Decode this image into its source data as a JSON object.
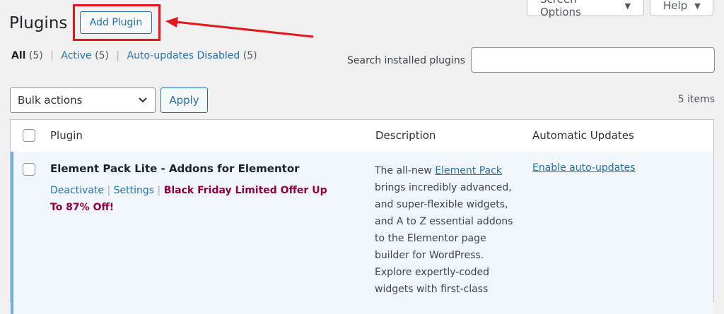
{
  "header": {
    "screen_options": "Screen Options",
    "help": "Help",
    "title": "Plugins",
    "add_plugin": "Add Plugin"
  },
  "filters": {
    "all_label": "All",
    "all_count": "(5)",
    "active_label": "Active",
    "active_count": "(5)",
    "autoupdates_label": "Auto-updates Disabled",
    "autoupdates_count": "(5)",
    "separator": "|"
  },
  "search": {
    "label": "Search installed plugins",
    "value": ""
  },
  "bulk": {
    "selected": "Bulk actions",
    "apply": "Apply",
    "items": "5 items"
  },
  "table": {
    "columns": [
      "Plugin",
      "Description",
      "Automatic Updates"
    ],
    "rows": [
      {
        "name": "Element Pack Lite - Addons for Elementor",
        "deactivate": "Deactivate",
        "settings": "Settings",
        "sep": "|",
        "promo": "Black Friday Limited Offer Up To 87% Off!",
        "desc_prefix": "The all-new ",
        "desc_link": "Element Pack",
        "desc_rest": " brings incredibly advanced, and super-flexible widgets, and A to Z essential addons to the Elementor page builder for WordPress. Explore expertly-coded widgets with first-class",
        "auto_update": "Enable auto-updates"
      }
    ]
  },
  "colors": {
    "accent": "#2271b1",
    "annotation": "#e3171b",
    "promo": "#93003f",
    "active_row": "#f0f6fc"
  }
}
